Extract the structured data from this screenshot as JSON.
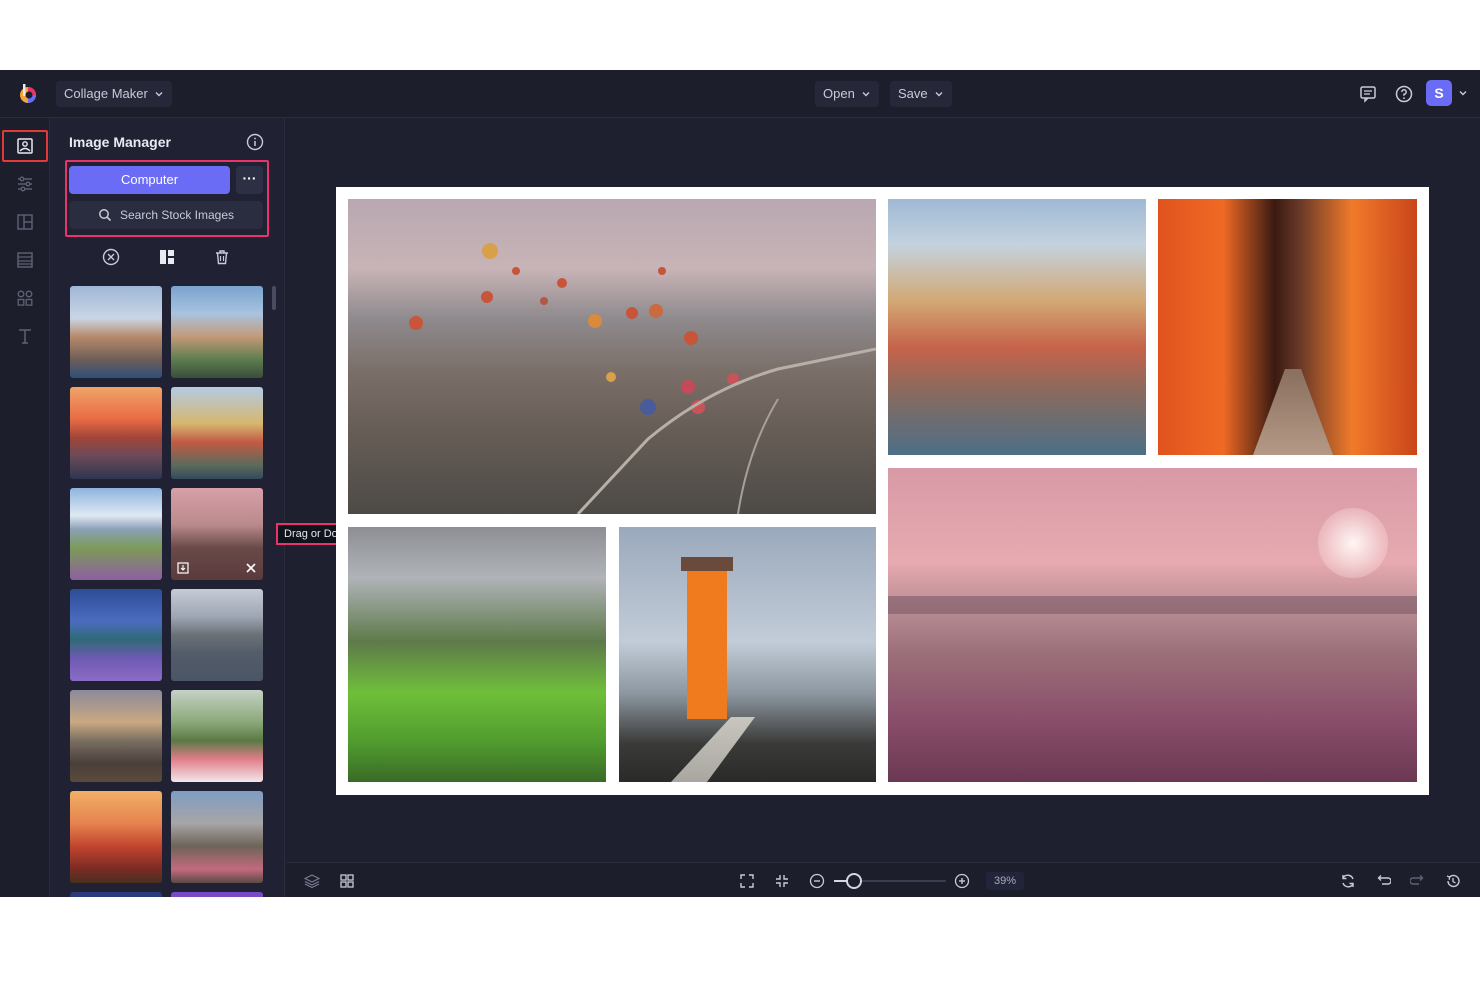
{
  "header": {
    "app_menu_label": "Collage Maker",
    "open_label": "Open",
    "save_label": "Save",
    "avatar_letter": "S"
  },
  "rail": {
    "items": [
      "image-manager-icon",
      "adjust-icon",
      "layout-icon",
      "backgrounds-icon",
      "graphics-icon",
      "text-icon"
    ]
  },
  "panel": {
    "title": "Image Manager",
    "computer_label": "Computer",
    "more_label": "···",
    "search_label": "Search Stock Images"
  },
  "tooltip": {
    "text": "Drag or Double Click"
  },
  "zoom": {
    "label": "39%",
    "fraction": 0.18
  },
  "colors": {
    "accent": "#6b6cf6",
    "highlight": "#e8336b",
    "rail_highlight": "#e03a3a"
  }
}
